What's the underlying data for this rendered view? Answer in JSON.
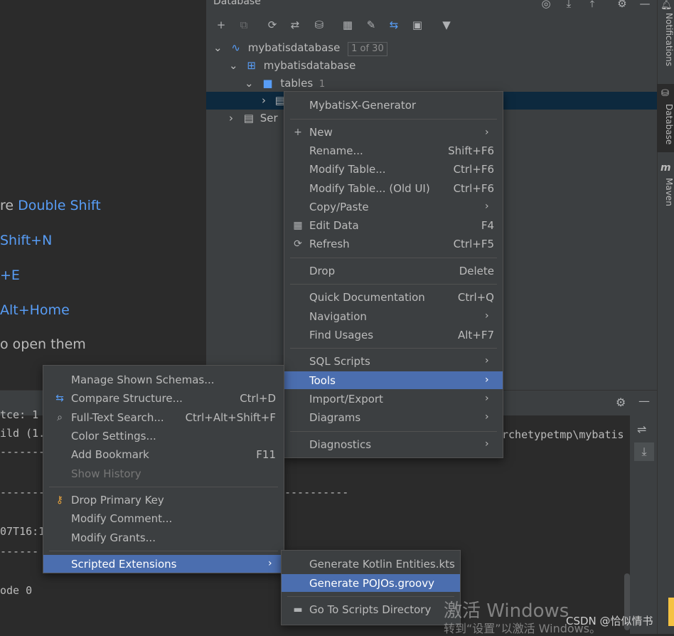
{
  "db_panel": {
    "title": "Database",
    "tree": {
      "root_label": "mybatisdatabase",
      "root_badge": "1 of 30",
      "schema_label": "mybatisdatabase",
      "tables_label": "tables",
      "tables_count": "1",
      "server_label_partial": "Ser"
    }
  },
  "editor_hints": [
    {
      "text": "re ",
      "key": "Double Shift"
    },
    {
      "text": "",
      "key": "Shift+N"
    },
    {
      "text": "",
      "key": "+E"
    },
    {
      "text": "",
      "key": "Alt+Home"
    },
    {
      "text": "o open them",
      "key": ""
    }
  ],
  "right_strip": {
    "notifications": "Notifications",
    "database": "Database",
    "maven": "Maven"
  },
  "console_lines": [
    "tce: 1",
    "ild (1.",
    "----------",
    "-----------",
    "----------",
    "07T16:1",
    "------",
    "ode 0",
    "rchetypetmp\\mybatis"
  ],
  "context_menu": {
    "header": "MybatisX-Generator",
    "items": [
      {
        "label": "New",
        "shortcut": ""
      },
      {
        "label": "Rename...",
        "shortcut": "Shift+F6"
      },
      {
        "label": "Modify Table...",
        "shortcut": "Ctrl+F6"
      },
      {
        "label": "Modify Table... (Old UI)",
        "shortcut": "Ctrl+F6"
      },
      {
        "label": "Copy/Paste",
        "shortcut": ""
      },
      {
        "label": "Edit Data",
        "shortcut": "F4"
      },
      {
        "label": "Refresh",
        "shortcut": "Ctrl+F5"
      },
      {
        "label": "Drop",
        "shortcut": "Delete"
      },
      {
        "label": "Quick Documentation",
        "shortcut": "Ctrl+Q"
      },
      {
        "label": "Navigation",
        "shortcut": ""
      },
      {
        "label": "Find Usages",
        "shortcut": "Alt+F7"
      },
      {
        "label": "SQL Scripts",
        "shortcut": ""
      },
      {
        "label": "Tools",
        "shortcut": ""
      },
      {
        "label": "Import/Export",
        "shortcut": ""
      },
      {
        "label": "Diagrams",
        "shortcut": ""
      },
      {
        "label": "Diagnostics",
        "shortcut": ""
      }
    ]
  },
  "tools_menu": {
    "items": [
      {
        "label": "Manage Shown Schemas...",
        "shortcut": ""
      },
      {
        "label": "Compare Structure...",
        "shortcut": "Ctrl+D"
      },
      {
        "label": "Full-Text Search...",
        "shortcut": "Ctrl+Alt+Shift+F"
      },
      {
        "label": "Color Settings...",
        "shortcut": ""
      },
      {
        "label": "Add Bookmark",
        "shortcut": "F11"
      },
      {
        "label": "Show History",
        "shortcut": ""
      },
      {
        "label": "Drop Primary Key",
        "shortcut": ""
      },
      {
        "label": "Modify Comment...",
        "shortcut": ""
      },
      {
        "label": "Modify Grants...",
        "shortcut": ""
      },
      {
        "label": "Scripted Extensions",
        "shortcut": ""
      }
    ]
  },
  "scripted_menu": {
    "items": [
      {
        "label": "Generate Kotlin Entities.kts"
      },
      {
        "label": "Generate POJOs.groovy"
      },
      {
        "label": "Go To Scripts Directory"
      }
    ]
  },
  "watermark": {
    "line1": "激活 Windows",
    "line2": "转到“设置”以激活 Windows。",
    "csdn": "CSDN @恰似情书"
  },
  "colors": {
    "highlight": "#4b6eaf",
    "link": "#589df6",
    "panel": "#3c3f41",
    "editor": "#2b2b2b"
  }
}
